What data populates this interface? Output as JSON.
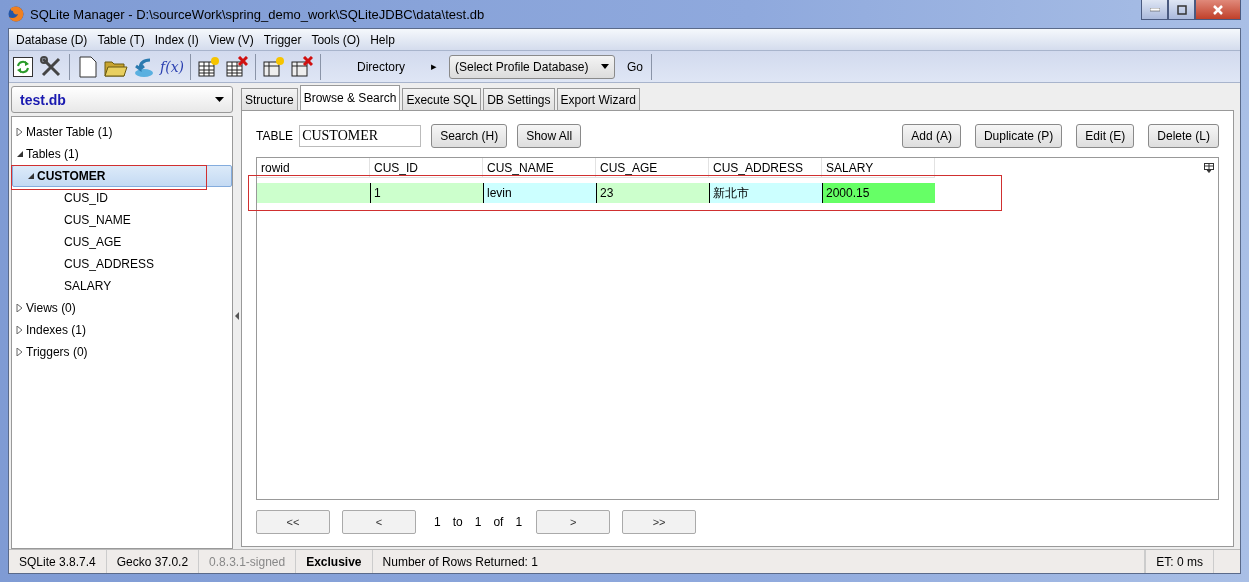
{
  "window": {
    "title": "SQLite Manager - D:\\sourceWork\\spring_demo_work\\SQLiteJDBC\\data\\test.db"
  },
  "menu": [
    "Database (D)",
    "Table (T)",
    "Index (I)",
    "View (V)",
    "Trigger",
    "Tools (O)",
    "Help"
  ],
  "toolbar": {
    "function_label": "f(x)",
    "directory_label": "Directory",
    "directory_arrow": "▸",
    "profile_select": "(Select Profile Database)",
    "go": "Go"
  },
  "database_select": "test.db",
  "tree": [
    {
      "label": "Master Table (1)",
      "expanded": false,
      "selected": false
    },
    {
      "label": "Tables (1)",
      "expanded": true,
      "selected": false,
      "children": [
        {
          "label": "CUSTOMER",
          "expanded": true,
          "selected": true,
          "highlighted": true,
          "children": [
            {
              "label": "CUS_ID",
              "selected": false
            },
            {
              "label": "CUS_NAME",
              "selected": false
            },
            {
              "label": "CUS_AGE",
              "selected": false
            },
            {
              "label": "CUS_ADDRESS",
              "selected": false
            },
            {
              "label": "SALARY",
              "selected": false
            }
          ]
        }
      ]
    },
    {
      "label": "Views (0)",
      "expanded": false,
      "selected": false
    },
    {
      "label": "Indexes (1)",
      "expanded": false,
      "selected": false
    },
    {
      "label": "Triggers (0)",
      "expanded": false,
      "selected": false
    }
  ],
  "tabs": [
    {
      "label": "Structure",
      "selected": false
    },
    {
      "label": "Browse & Search",
      "selected": true
    },
    {
      "label": "Execute SQL",
      "selected": false
    },
    {
      "label": "DB Settings",
      "selected": false
    },
    {
      "label": "Export Wizard",
      "selected": false
    }
  ],
  "browse": {
    "table_label": "TABLE",
    "table_value": "CUSTOMER",
    "left_buttons": [
      "Search (H)",
      "Show All"
    ],
    "right_buttons": [
      "Add (A)",
      "Duplicate (P)",
      "Edit (E)",
      "Delete (L)"
    ]
  },
  "table": {
    "columns": [
      "rowid",
      "CUS_ID",
      "CUS_NAME",
      "CUS_AGE",
      "CUS_ADDRESS",
      "SALARY"
    ],
    "rows": [
      {
        "highlighted": true,
        "cells": [
          {
            "color": "#ccffcc"
          },
          {
            "value": "1",
            "color": "#ccffcc"
          },
          {
            "value": "levin",
            "color": "#ccffff"
          },
          {
            "value": "23",
            "color": "#ccffcc"
          },
          {
            "value": "新北市",
            "color": "#ccffff"
          },
          {
            "value": "2000.15",
            "color": "#66ff66"
          }
        ]
      }
    ]
  },
  "pager": {
    "first": "<<",
    "prev": "<",
    "from": "1",
    "to_label": "to",
    "to": "1",
    "of_label": "of",
    "total": "1",
    "next": ">",
    "last": ">>"
  },
  "status_bar": [
    {
      "text": "SQLite 3.8.7.4",
      "kind": "normal"
    },
    {
      "text": "Gecko 37.0.2",
      "kind": "normal"
    },
    {
      "text": "0.8.3.1-signed",
      "kind": "dim"
    },
    {
      "text": "Exclusive",
      "kind": "strong"
    },
    {
      "text": "Number of Rows Returned: 1",
      "kind": "wide"
    },
    {
      "text": "ET: 0 ms",
      "kind": "right"
    }
  ]
}
